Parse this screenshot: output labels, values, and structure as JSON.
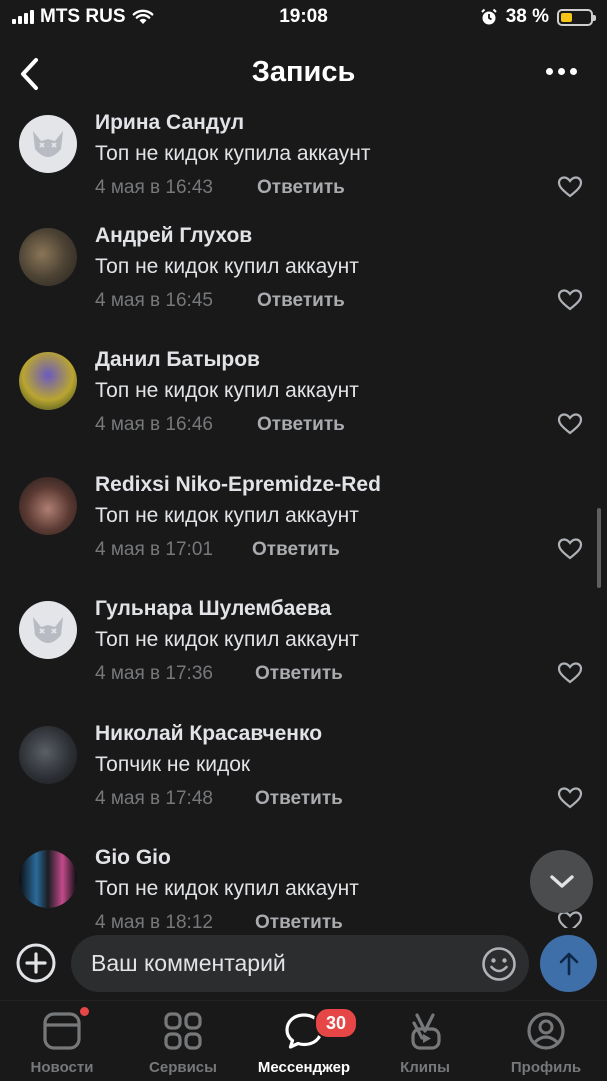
{
  "status_bar": {
    "carrier": "MTS RUS",
    "time": "19:08",
    "battery": "38 %",
    "battery_level": 0.38
  },
  "header": {
    "title": "Запись"
  },
  "comments": [
    {
      "name": "Ирина Сандул",
      "text": "Топ не кидок купила аккаунт",
      "date": "4 мая в 16:43",
      "reply": "Ответить",
      "avatar": "default-avatar"
    },
    {
      "name": "Андрей Глухов",
      "text": "Топ не кидок купил аккаунт",
      "date": "4 мая в 16:45",
      "reply": "Ответить",
      "avatar": "photo-avatar"
    },
    {
      "name": "Данил Батыров",
      "text": "Топ не кидок купил аккаунт",
      "date": "4 мая в 16:46",
      "reply": "Ответить",
      "avatar": "photo-avatar"
    },
    {
      "name": "Redixsi Niko-Epremidze-Red",
      "text": "Топ не кидок купил аккаунт",
      "date": "4 мая в 17:01",
      "reply": "Ответить",
      "avatar": "photo-avatar"
    },
    {
      "name": "Гульнара Шулембаева",
      "text": "Топ не кидок купил аккаунт",
      "date": "4 мая в 17:36",
      "reply": "Ответить",
      "avatar": "default-avatar"
    },
    {
      "name": "Николай Красавченко",
      "text": "Топчик не кидок",
      "date": "4 мая в 17:48",
      "reply": "Ответить",
      "avatar": "photo-avatar"
    },
    {
      "name": "Gio Gio",
      "text": "Топ не кидок купил аккаунт",
      "date": "4 мая в 18:12",
      "reply": "Ответить",
      "avatar": "photo-avatar"
    }
  ],
  "composer": {
    "placeholder": "Ваш комментарий"
  },
  "tabs": [
    {
      "label": "Новости",
      "icon": "news-icon",
      "badge_dot": true
    },
    {
      "label": "Сервисы",
      "icon": "services-icon"
    },
    {
      "label": "Мессенджер",
      "icon": "messenger-icon",
      "badge": "30",
      "active": true
    },
    {
      "label": "Клипы",
      "icon": "clips-icon"
    },
    {
      "label": "Профиль",
      "icon": "profile-icon"
    }
  ],
  "colors": {
    "background": "#19191a",
    "accent": "#3f6fa8",
    "badge": "#e64646",
    "battery": "#f5c518"
  }
}
